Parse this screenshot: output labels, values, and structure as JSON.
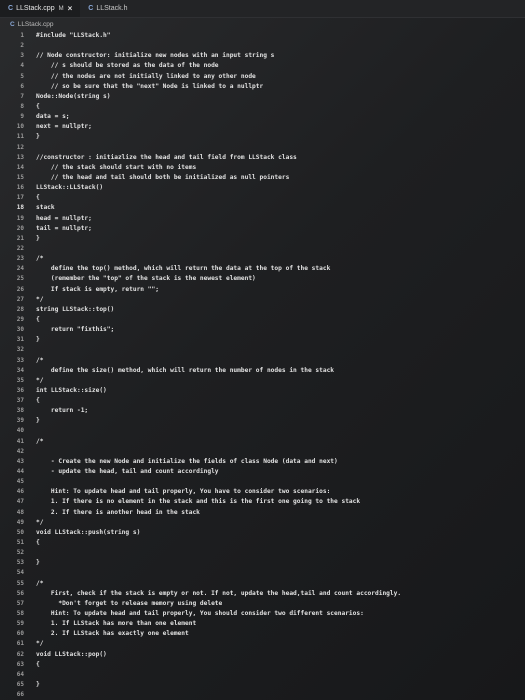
{
  "tabs": [
    {
      "icon": "cpp-file-icon",
      "label": "LLStack.cpp",
      "modified": "M",
      "close": "×",
      "active": true
    },
    {
      "icon": "header-file-icon",
      "label": "LLStack.h",
      "active": false
    }
  ],
  "breadcrumb": {
    "file": "LLStack.cpp"
  },
  "current_line": 18,
  "lines": [
    {
      "n": "1",
      "code": "#include \"LLStack.h\""
    },
    {
      "n": "2",
      "code": ""
    },
    {
      "n": "3",
      "code": "// Node constructor: initialize new nodes with an input string s"
    },
    {
      "n": "4",
      "code": "    // s should be stored as the data of the node"
    },
    {
      "n": "5",
      "code": "    // the nodes are not initially linked to any other node"
    },
    {
      "n": "6",
      "code": "    // so be sure that the \"next\" Node is linked to a nullptr"
    },
    {
      "n": "7",
      "code": "Node::Node(string s)"
    },
    {
      "n": "8",
      "code": "{"
    },
    {
      "n": "9",
      "code": "data = s;"
    },
    {
      "n": "10",
      "code": "next = nullptr;"
    },
    {
      "n": "11",
      "code": "}"
    },
    {
      "n": "12",
      "code": ""
    },
    {
      "n": "13",
      "code": "//constructor : initiazlize the head and tail field from LLStack class"
    },
    {
      "n": "14",
      "code": "    // the stack should start with no items"
    },
    {
      "n": "15",
      "code": "    // the head and tail should both be initialized as null pointers"
    },
    {
      "n": "16",
      "code": "LLStack::LLStack()"
    },
    {
      "n": "17",
      "code": "{"
    },
    {
      "n": "18",
      "code": "stack"
    },
    {
      "n": "19",
      "code": "head = nullptr;"
    },
    {
      "n": "20",
      "code": "tail = nullptr;"
    },
    {
      "n": "21",
      "code": "}"
    },
    {
      "n": "22",
      "code": ""
    },
    {
      "n": "23",
      "code": "/*"
    },
    {
      "n": "24",
      "code": "    define the top() method, which will return the data at the top of the stack"
    },
    {
      "n": "25",
      "code": "    (remember the \"top\" of the stack is the newest element)"
    },
    {
      "n": "26",
      "code": "    If stack is empty, return \"\";"
    },
    {
      "n": "27",
      "code": "*/"
    },
    {
      "n": "28",
      "code": "string LLStack::top()"
    },
    {
      "n": "29",
      "code": "{"
    },
    {
      "n": "30",
      "code": "    return \"fixthis\";"
    },
    {
      "n": "31",
      "code": "}"
    },
    {
      "n": "32",
      "code": ""
    },
    {
      "n": "33",
      "code": "/*"
    },
    {
      "n": "34",
      "code": "    define the size() method, which will return the number of nodes in the stack"
    },
    {
      "n": "35",
      "code": "*/"
    },
    {
      "n": "36",
      "code": "int LLStack::size()"
    },
    {
      "n": "37",
      "code": "{"
    },
    {
      "n": "38",
      "code": "    return -1;"
    },
    {
      "n": "39",
      "code": "}"
    },
    {
      "n": "40",
      "code": ""
    },
    {
      "n": "41",
      "code": "/*"
    },
    {
      "n": "42",
      "code": ""
    },
    {
      "n": "43",
      "code": "    - Create the new Node and initialize the fields of class Node (data and next)"
    },
    {
      "n": "44",
      "code": "    - update the head, tail and count accordingly"
    },
    {
      "n": "45",
      "code": ""
    },
    {
      "n": "46",
      "code": "    Hint: To update head and tail properly, You have to consider two scenarios:"
    },
    {
      "n": "47",
      "code": "    1. If there is no element in the stack and this is the first one going to the stack"
    },
    {
      "n": "48",
      "code": "    2. If there is another head in the stack"
    },
    {
      "n": "49",
      "code": "*/"
    },
    {
      "n": "50",
      "code": "void LLStack::push(string s)"
    },
    {
      "n": "51",
      "code": "{"
    },
    {
      "n": "52",
      "code": ""
    },
    {
      "n": "53",
      "code": "}"
    },
    {
      "n": "54",
      "code": ""
    },
    {
      "n": "55",
      "code": "/*"
    },
    {
      "n": "56",
      "code": "    First, check if the stack is empty or not. If not, update the head,tail and count accordingly."
    },
    {
      "n": "57",
      "code": "      *Don't forget to release memory using delete"
    },
    {
      "n": "58",
      "code": "    Hint: To update head and tail properly, You should consider two different scenarios:"
    },
    {
      "n": "59",
      "code": "    1. If LLStack has more than one element"
    },
    {
      "n": "60",
      "code": "    2. If LLStack has exactly one element"
    },
    {
      "n": "61",
      "code": "*/"
    },
    {
      "n": "62",
      "code": "void LLStack::pop()"
    },
    {
      "n": "63",
      "code": "{"
    },
    {
      "n": "64",
      "code": ""
    },
    {
      "n": "65",
      "code": "}"
    },
    {
      "n": "66",
      "code": ""
    }
  ]
}
